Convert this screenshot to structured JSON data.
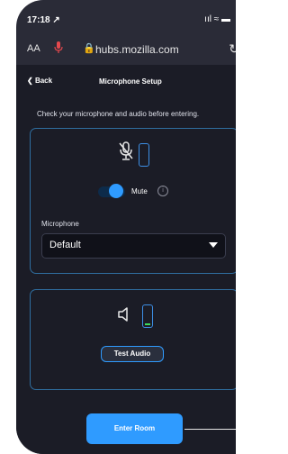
{
  "status_bar": {
    "time": "17:18 ↗",
    "icons": "ııl ≈ ▬"
  },
  "browser": {
    "text_size_label": "AA",
    "mic_indicator": "microphone-icon",
    "lock_icon": "🔒",
    "url": "hubs.mozilla.com",
    "reload_icon": "↻"
  },
  "header": {
    "back_label": "Back",
    "title": "Microphone Setup"
  },
  "instruction": "Check your microphone and audio before entering.",
  "mic_panel": {
    "mute_label": "Mute",
    "mute_on": true,
    "info_icon": "i",
    "microphone_label": "Microphone",
    "microphone_selected": "Default"
  },
  "audio_panel": {
    "speaker_icon": "speaker-icon",
    "output_level": 0.1,
    "test_audio_label": "Test Audio"
  },
  "enter_room_label": "Enter Room",
  "colors": {
    "accent": "#2f9bff",
    "background": "#1b1c26",
    "panel_border": "#2f6ea0",
    "level_green": "#3ddc5c"
  }
}
